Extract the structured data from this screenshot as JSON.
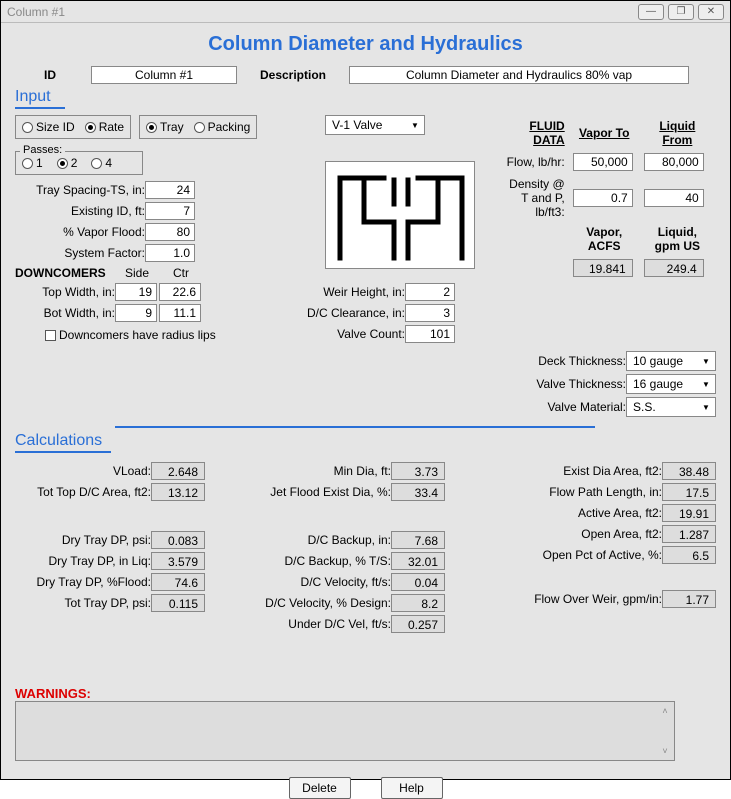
{
  "window": {
    "title": "Column #1"
  },
  "page_title": "Column Diameter and Hydraulics",
  "header": {
    "id_label": "ID",
    "id_value": "Column #1",
    "desc_label": "Description",
    "desc_value": "Column Diameter and Hydraulics 80% vap"
  },
  "input": {
    "section": "Input",
    "mode": {
      "size_id": "Size ID",
      "rate": "Rate",
      "selected": "rate"
    },
    "type": {
      "tray": "Tray",
      "packing": "Packing",
      "selected": "tray"
    },
    "tray_type": "V-1 Valve",
    "passes": {
      "label": "Passes:",
      "options": [
        "1",
        "2",
        "4"
      ],
      "selected": "2"
    },
    "fields": {
      "tray_spacing": {
        "label": "Tray Spacing-TS, in:",
        "value": "24"
      },
      "existing_id": {
        "label": "Existing ID, ft:",
        "value": "7"
      },
      "vapor_flood": {
        "label": "% Vapor Flood:",
        "value": "80"
      },
      "system_factor": {
        "label": "System Factor:",
        "value": "1.0"
      }
    },
    "downcomers": {
      "title": "DOWNCOMERS",
      "side": "Side",
      "ctr": "Ctr",
      "top_width": {
        "label": "Top Width, in:",
        "side": "19",
        "ctr": "22.6"
      },
      "bot_width": {
        "label": "Bot Width, in:",
        "side": "9",
        "ctr": "11.1"
      },
      "radius_lips": "Downcomers have radius lips"
    },
    "mid": {
      "weir_height": {
        "label": "Weir Height, in:",
        "value": "2"
      },
      "dc_clearance": {
        "label": "D/C Clearance, in:",
        "value": "3"
      },
      "valve_count": {
        "label": "Valve Count:",
        "value": "101"
      },
      "deck_thickness": {
        "label": "Deck Thickness:",
        "value": "10 gauge"
      },
      "valve_thickness": {
        "label": "Valve Thickness:",
        "value": "16 gauge"
      },
      "valve_material": {
        "label": "Valve Material:",
        "value": "S.S."
      }
    },
    "fluid": {
      "title": "FLUID DATA",
      "vapor_to": "Vapor To",
      "liquid_from": "Liquid From",
      "flow": {
        "label": "Flow, lb/hr:",
        "vapor": "50,000",
        "liquid": "80,000"
      },
      "density": {
        "label": "Density @ T and P, lb/ft3:",
        "vapor": "0.7",
        "liquid": "40"
      },
      "vapor_acfs": {
        "label": "Vapor, ACFS",
        "value": "19.841"
      },
      "liquid_gpm": {
        "label": "Liquid, gpm US",
        "value": "249.4"
      }
    }
  },
  "calc": {
    "section": "Calculations",
    "left": {
      "vload": {
        "label": "VLoad:",
        "value": "2.648"
      },
      "tot_top_dc": {
        "label": "Tot Top D/C Area, ft2:",
        "value": "13.12"
      },
      "dry_tray_dp_psi": {
        "label": "Dry Tray DP, psi:",
        "value": "0.083"
      },
      "dry_tray_dp_liq": {
        "label": "Dry Tray DP, in Liq:",
        "value": "3.579"
      },
      "dry_tray_dp_flood": {
        "label": "Dry Tray DP, %Flood:",
        "value": "74.6"
      },
      "tot_tray_dp": {
        "label": "Tot Tray DP, psi:",
        "value": "0.115"
      }
    },
    "mid": {
      "min_dia": {
        "label": "Min Dia, ft:",
        "value": "3.73"
      },
      "jet_flood": {
        "label": "Jet Flood Exist Dia, %:",
        "value": "33.4"
      },
      "dc_backup_in": {
        "label": "D/C Backup, in:",
        "value": "7.68"
      },
      "dc_backup_pct": {
        "label": "D/C Backup, % T/S:",
        "value": "32.01"
      },
      "dc_velocity": {
        "label": "D/C Velocity, ft/s:",
        "value": "0.04"
      },
      "dc_vel_design": {
        "label": "D/C Velocity, % Design:",
        "value": "8.2"
      },
      "under_dc_vel": {
        "label": "Under D/C Vel, ft/s:",
        "value": "0.257"
      }
    },
    "right": {
      "exist_dia_area": {
        "label": "Exist Dia Area, ft2:",
        "value": "38.48"
      },
      "flow_path_len": {
        "label": "Flow Path Length, in:",
        "value": "17.5"
      },
      "active_area": {
        "label": "Active Area, ft2:",
        "value": "19.91"
      },
      "open_area": {
        "label": "Open Area, ft2:",
        "value": "1.287"
      },
      "open_pct_active": {
        "label": "Open Pct of Active, %:",
        "value": "6.5"
      },
      "flow_over_weir": {
        "label": "Flow Over Weir, gpm/in:",
        "value": "1.77"
      }
    }
  },
  "warnings": {
    "label": "WARNINGS:"
  },
  "buttons": {
    "delete": "Delete",
    "help": "Help"
  }
}
